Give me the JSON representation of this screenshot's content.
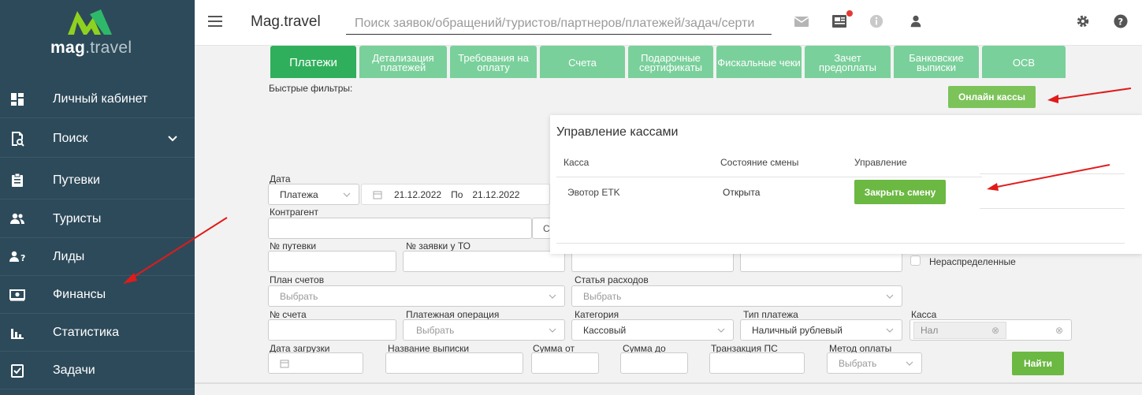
{
  "sidebar": {
    "logo": {
      "bold": "mag",
      "rest": ".travel"
    },
    "items": [
      {
        "label": "Личный кабинет",
        "icon": "dashboard-icon"
      },
      {
        "label": "Поиск",
        "icon": "search-doc-icon"
      },
      {
        "label": "Путевки",
        "icon": "clipboard-icon"
      },
      {
        "label": "Туристы",
        "icon": "users-icon"
      },
      {
        "label": "Лиды",
        "icon": "lead-icon"
      },
      {
        "label": "Финансы",
        "icon": "money-icon"
      },
      {
        "label": "Статистика",
        "icon": "bar-chart-icon"
      },
      {
        "label": "Задачи",
        "icon": "task-icon"
      }
    ]
  },
  "header": {
    "brand": "Mag.travel",
    "search_placeholder": "Поиск заявок/обращений/туристов/партнеров/платежей/задач/серти"
  },
  "tabs": [
    {
      "label": "Платежи",
      "active": true
    },
    {
      "label": "Детализация платежей"
    },
    {
      "label": "Требования на оплату"
    },
    {
      "label": "Счета"
    },
    {
      "label": "Подарочные сертификаты"
    },
    {
      "label": "Фискальные чеки"
    },
    {
      "label": "Зачет предоплаты"
    },
    {
      "label": "Банковские выписки"
    },
    {
      "label": "ОСВ"
    }
  ],
  "filters": {
    "quick_filters_label": "Быстрые фильтры:",
    "online_cashboxes_button": "Онлайн кассы",
    "date_label": "Дата",
    "date_type": "Платежа",
    "date_from": "21.12.2022",
    "date_to_label": "По",
    "date_to": "21.12.2022",
    "counterparty_label": "Контрагент",
    "counterparty_search_letter": "С",
    "voucher_label": "№ путевки",
    "to_request_label": "№ заявки у ТО",
    "unassigned_label": "Нераспределенные",
    "chart_of_accounts_label": "План счетов",
    "chart_of_accounts_value": "Выбрать",
    "expense_item_label": "Статья расходов",
    "expense_item_value": "Выбрать",
    "account_no_label": "№ счета",
    "payment_operation_label": "Платежная операция",
    "payment_operation_value": "Выбрать",
    "category_label": "Категория",
    "category_value": "Кассовый",
    "payment_type_label": "Тип платежа",
    "payment_type_value": "Наличный рублевый",
    "cashbox_label": "Касса",
    "cashbox_tag": "Нал",
    "upload_date_label": "Дата загрузки",
    "statement_name_label": "Название выписки",
    "amount_from_label": "Сумма от",
    "amount_to_label": "Сумма до",
    "ps_transaction_label": "Транзакция ПС",
    "payment_method_label": "Метод оплаты",
    "payment_method_value": "Выбрать",
    "find_button": "Найти"
  },
  "cash_popup": {
    "title": "Управление кассами",
    "columns": [
      "Касса",
      "Состояние смены",
      "Управление"
    ],
    "row": {
      "cashbox": "Эвотор ETK",
      "state": "Открыта",
      "action": "Закрыть смену"
    }
  },
  "colors": {
    "sidebar_bg": "#2d4a5a",
    "tab_active": "#2faf5c",
    "tab": "#7ad09b",
    "button_green": "#6bb842",
    "arrow": "#e01b1b"
  }
}
